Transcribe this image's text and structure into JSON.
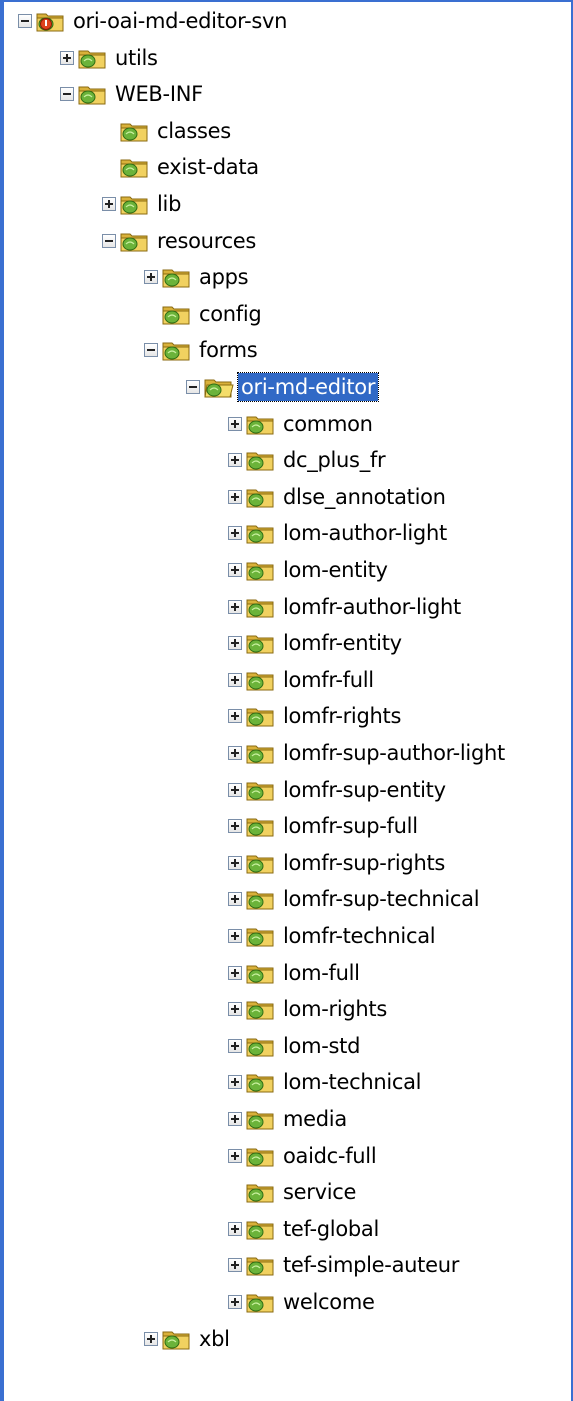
{
  "accent": "#3169c6",
  "tree": [
    {
      "label": "ori-oai-md-editor-svn",
      "depth": 0,
      "toggle": "minus",
      "icon": "project-folder-icon",
      "selected": false
    },
    {
      "label": "utils",
      "depth": 1,
      "toggle": "plus",
      "icon": "folder-icon",
      "selected": false
    },
    {
      "label": "WEB-INF",
      "depth": 1,
      "toggle": "minus",
      "icon": "folder-icon",
      "selected": false
    },
    {
      "label": "classes",
      "depth": 2,
      "toggle": "none",
      "icon": "folder-icon",
      "selected": false
    },
    {
      "label": "exist-data",
      "depth": 2,
      "toggle": "none",
      "icon": "folder-icon",
      "selected": false
    },
    {
      "label": "lib",
      "depth": 2,
      "toggle": "plus",
      "icon": "folder-icon",
      "selected": false
    },
    {
      "label": "resources",
      "depth": 2,
      "toggle": "minus",
      "icon": "folder-icon",
      "selected": false
    },
    {
      "label": "apps",
      "depth": 3,
      "toggle": "plus",
      "icon": "folder-icon",
      "selected": false
    },
    {
      "label": "config",
      "depth": 3,
      "toggle": "none",
      "icon": "folder-icon",
      "selected": false
    },
    {
      "label": "forms",
      "depth": 3,
      "toggle": "minus",
      "icon": "folder-icon",
      "selected": false
    },
    {
      "label": "ori-md-editor",
      "depth": 4,
      "toggle": "minus",
      "icon": "open-folder-icon",
      "selected": true
    },
    {
      "label": "common",
      "depth": 5,
      "toggle": "plus",
      "icon": "folder-icon",
      "selected": false
    },
    {
      "label": "dc_plus_fr",
      "depth": 5,
      "toggle": "plus",
      "icon": "folder-icon",
      "selected": false
    },
    {
      "label": "dlse_annotation",
      "depth": 5,
      "toggle": "plus",
      "icon": "folder-icon",
      "selected": false
    },
    {
      "label": "lom-author-light",
      "depth": 5,
      "toggle": "plus",
      "icon": "folder-icon",
      "selected": false
    },
    {
      "label": "lom-entity",
      "depth": 5,
      "toggle": "plus",
      "icon": "folder-icon",
      "selected": false
    },
    {
      "label": "lomfr-author-light",
      "depth": 5,
      "toggle": "plus",
      "icon": "folder-icon",
      "selected": false
    },
    {
      "label": "lomfr-entity",
      "depth": 5,
      "toggle": "plus",
      "icon": "folder-icon",
      "selected": false
    },
    {
      "label": "lomfr-full",
      "depth": 5,
      "toggle": "plus",
      "icon": "folder-icon",
      "selected": false
    },
    {
      "label": "lomfr-rights",
      "depth": 5,
      "toggle": "plus",
      "icon": "folder-icon",
      "selected": false
    },
    {
      "label": "lomfr-sup-author-light",
      "depth": 5,
      "toggle": "plus",
      "icon": "folder-icon",
      "selected": false
    },
    {
      "label": "lomfr-sup-entity",
      "depth": 5,
      "toggle": "plus",
      "icon": "folder-icon",
      "selected": false
    },
    {
      "label": "lomfr-sup-full",
      "depth": 5,
      "toggle": "plus",
      "icon": "folder-icon",
      "selected": false
    },
    {
      "label": "lomfr-sup-rights",
      "depth": 5,
      "toggle": "plus",
      "icon": "folder-icon",
      "selected": false
    },
    {
      "label": "lomfr-sup-technical",
      "depth": 5,
      "toggle": "plus",
      "icon": "folder-icon",
      "selected": false
    },
    {
      "label": "lomfr-technical",
      "depth": 5,
      "toggle": "plus",
      "icon": "folder-icon",
      "selected": false
    },
    {
      "label": "lom-full",
      "depth": 5,
      "toggle": "plus",
      "icon": "folder-icon",
      "selected": false
    },
    {
      "label": "lom-rights",
      "depth": 5,
      "toggle": "plus",
      "icon": "folder-icon",
      "selected": false
    },
    {
      "label": "lom-std",
      "depth": 5,
      "toggle": "plus",
      "icon": "folder-icon",
      "selected": false
    },
    {
      "label": "lom-technical",
      "depth": 5,
      "toggle": "plus",
      "icon": "folder-icon",
      "selected": false
    },
    {
      "label": "media",
      "depth": 5,
      "toggle": "plus",
      "icon": "folder-icon",
      "selected": false
    },
    {
      "label": "oaidc-full",
      "depth": 5,
      "toggle": "plus",
      "icon": "folder-icon",
      "selected": false
    },
    {
      "label": "service",
      "depth": 5,
      "toggle": "none",
      "icon": "folder-icon",
      "selected": false
    },
    {
      "label": "tef-global",
      "depth": 5,
      "toggle": "plus",
      "icon": "folder-icon",
      "selected": false
    },
    {
      "label": "tef-simple-auteur",
      "depth": 5,
      "toggle": "plus",
      "icon": "folder-icon",
      "selected": false
    },
    {
      "label": "welcome",
      "depth": 5,
      "toggle": "plus",
      "icon": "folder-icon",
      "selected": false
    },
    {
      "label": "xbl",
      "depth": 3,
      "toggle": "plus",
      "icon": "folder-icon",
      "selected": false
    }
  ]
}
